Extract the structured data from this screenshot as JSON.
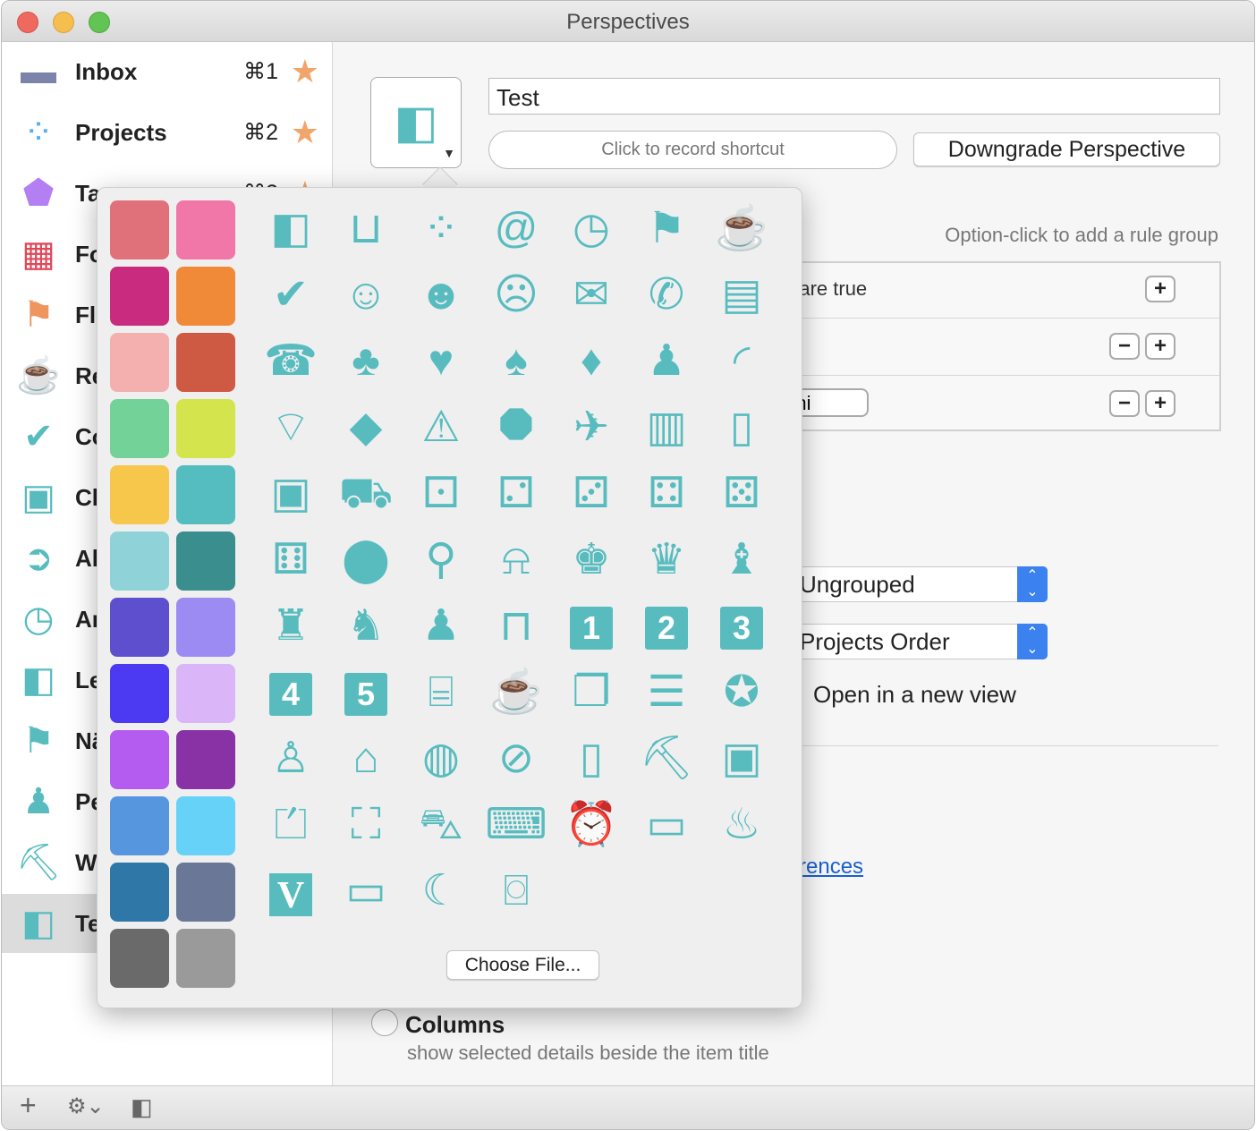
{
  "window": {
    "title": "Perspectives"
  },
  "sidebar": {
    "items": [
      {
        "label": "Inbox",
        "shortcut": "⌘1",
        "icon": "inbox-icon",
        "glyph": "▬",
        "color": "#7c84ac",
        "star": true
      },
      {
        "label": "Projects",
        "shortcut": "⌘2",
        "icon": "projects-icon",
        "glyph": "⁘",
        "color": "#58aef6",
        "star": true
      },
      {
        "label": "Ta",
        "shortcut": "⌘3",
        "icon": "tag-icon",
        "glyph": "⬟",
        "color": "#b37ff2",
        "star": true
      },
      {
        "label": "Fo",
        "icon": "forecast-icon",
        "glyph": "▦",
        "color": "#e0485a"
      },
      {
        "label": "Fl",
        "icon": "flag-icon",
        "glyph": "⚑",
        "color": "#ee9560"
      },
      {
        "label": "Re",
        "icon": "coffee-cup-icon",
        "glyph": "☕",
        "color": "#8e7ee4"
      },
      {
        "label": "Co",
        "icon": "checkmark-icon",
        "glyph": "✔",
        "color": "#58bcbf"
      },
      {
        "label": "Ch",
        "icon": "calendar-icon",
        "glyph": "▣",
        "color": "#58bcbf"
      },
      {
        "label": "Ak",
        "icon": "chevron-circle-icon",
        "glyph": "➲",
        "color": "#58bcbf"
      },
      {
        "label": "Ar",
        "icon": "clock-icon",
        "glyph": "◷",
        "color": "#58bcbf"
      },
      {
        "label": "Le",
        "icon": "perspective-icon",
        "glyph": "◧",
        "color": "#58bcbf"
      },
      {
        "label": "Nä",
        "icon": "flag-icon",
        "glyph": "⚑",
        "color": "#58bcbf"
      },
      {
        "label": "Pe",
        "icon": "person-icon",
        "glyph": "♟",
        "color": "#58bcbf"
      },
      {
        "label": "W",
        "icon": "toolbox-icon",
        "glyph": "⛏",
        "color": "#58bcbf"
      },
      {
        "label": "Te",
        "icon": "perspective-icon",
        "glyph": "◧",
        "color": "#58bcbf",
        "selected": true
      }
    ]
  },
  "bottom_bar": {
    "add": "+",
    "gear": "⚙⌄",
    "sidebar_toggle": "◧"
  },
  "editor": {
    "name_value": "Test",
    "shortcut_placeholder": "Click to record shortcut",
    "downgrade_label": "Downgrade Perspective",
    "rule_hint": "Option-click to add a rule group",
    "rule_text": "g are true",
    "omni_value": "Omni",
    "grouping_value": "Ungrouped",
    "sorting_value": "Projects Order",
    "open_new_view_label": "Open in a new view",
    "link_text": "rences",
    "columns_label": "Columns",
    "columns_desc": "show selected details beside the item title"
  },
  "popover": {
    "choose_file": "Choose File...",
    "accent": "#58bcbf",
    "swatches": [
      "#e0707a",
      "#f077a8",
      "#c92c7f",
      "#f08a38",
      "#f3b0ae",
      "#cf5a43",
      "#72d298",
      "#d3e44c",
      "#f6c74a",
      "#55bcbf",
      "#8fd3d8",
      "#3a8e8d",
      "#5e4fce",
      "#9b8bf3",
      "#4b3af1",
      "#dab5f7",
      "#b45bf0",
      "#8932a5",
      "#5596de",
      "#67d2f8",
      "#2f77a6",
      "#6b7796",
      "#6a6a6a",
      "#9a9a9a"
    ],
    "icons": [
      {
        "name": "perspective-icon",
        "glyph": "◧"
      },
      {
        "name": "inbox-tray-icon",
        "glyph": "⊔"
      },
      {
        "name": "projects-dots-icon",
        "glyph": "⁘"
      },
      {
        "name": "at-sign-icon",
        "glyph": "@"
      },
      {
        "name": "clock-icon",
        "glyph": "◷"
      },
      {
        "name": "flag-icon",
        "glyph": "⚑"
      },
      {
        "name": "cup-icon",
        "glyph": "☕"
      },
      {
        "name": "checkmark-circle-icon",
        "glyph": "✔"
      },
      {
        "name": "smile-icon",
        "glyph": "☺"
      },
      {
        "name": "neutral-face-icon",
        "glyph": "☻"
      },
      {
        "name": "sad-face-icon",
        "glyph": "☹"
      },
      {
        "name": "envelope-icon",
        "glyph": "✉"
      },
      {
        "name": "phone-handset-icon",
        "glyph": "✆"
      },
      {
        "name": "floppy-disk-icon",
        "glyph": "▤"
      },
      {
        "name": "telephone-icon",
        "glyph": "☎"
      },
      {
        "name": "club-icon",
        "glyph": "♣"
      },
      {
        "name": "heart-icon",
        "glyph": "♥"
      },
      {
        "name": "spade-icon",
        "glyph": "♠"
      },
      {
        "name": "diamond-icon",
        "glyph": "♦"
      },
      {
        "name": "person-icon",
        "glyph": "♟"
      },
      {
        "name": "rss-icon",
        "glyph": "◜"
      },
      {
        "name": "wifi-icon",
        "glyph": "⌔"
      },
      {
        "name": "warning-diamond-icon",
        "glyph": "◆"
      },
      {
        "name": "warning-triangle-icon",
        "glyph": "⚠"
      },
      {
        "name": "warning-octagon-icon",
        "glyph": "⯃"
      },
      {
        "name": "airplane-icon",
        "glyph": "✈"
      },
      {
        "name": "bus-icon",
        "glyph": "▥"
      },
      {
        "name": "train-icon",
        "glyph": "▯"
      },
      {
        "name": "bus-front-icon",
        "glyph": "▣"
      },
      {
        "name": "taxi-icon",
        "glyph": "⛟"
      },
      {
        "name": "die-one-icon",
        "glyph": "⚀"
      },
      {
        "name": "die-two-icon",
        "glyph": "⚁"
      },
      {
        "name": "die-three-icon",
        "glyph": "⚂"
      },
      {
        "name": "die-four-icon",
        "glyph": "⚃"
      },
      {
        "name": "die-five-icon",
        "glyph": "⚄"
      },
      {
        "name": "die-six-icon",
        "glyph": "⚅"
      },
      {
        "name": "eight-ball-icon",
        "glyph": "⬤"
      },
      {
        "name": "lightbulb-icon",
        "glyph": "⚲"
      },
      {
        "name": "bell-icon",
        "glyph": "⍾"
      },
      {
        "name": "chess-king-icon",
        "glyph": "♚"
      },
      {
        "name": "crown-icon",
        "glyph": "♛"
      },
      {
        "name": "chess-bishop-icon",
        "glyph": "♝"
      },
      {
        "name": "chess-rook-icon",
        "glyph": "♜"
      },
      {
        "name": "chess-knight-icon",
        "glyph": "♞"
      },
      {
        "name": "chess-pawn-icon",
        "glyph": "♟"
      },
      {
        "name": "lock-icon",
        "glyph": "⊓"
      },
      {
        "name": "number-one-icon",
        "label": "1"
      },
      {
        "name": "number-two-icon",
        "label": "2"
      },
      {
        "name": "number-three-icon",
        "label": "3"
      },
      {
        "name": "number-four-icon",
        "label": "4"
      },
      {
        "name": "number-five-icon",
        "label": "5"
      },
      {
        "name": "blueprint-icon",
        "glyph": "⌸"
      },
      {
        "name": "mug-icon",
        "glyph": "☕"
      },
      {
        "name": "documents-icon",
        "glyph": "❐"
      },
      {
        "name": "archive-tray-icon",
        "glyph": "☰"
      },
      {
        "name": "star-badge-icon",
        "glyph": "✪"
      },
      {
        "name": "doctor-icon",
        "glyph": "♙"
      },
      {
        "name": "house-icon",
        "glyph": "⌂"
      },
      {
        "name": "tennis-ball-icon",
        "glyph": "◍"
      },
      {
        "name": "safe-icon",
        "glyph": "⊘"
      },
      {
        "name": "smartphone-icon",
        "glyph": "▯"
      },
      {
        "name": "toolbox-icon",
        "glyph": "⛏"
      },
      {
        "name": "calendar-icon",
        "glyph": "▣"
      },
      {
        "name": "scanner-icon",
        "glyph": "⏍"
      },
      {
        "name": "gamepad-icon",
        "glyph": "⛶"
      },
      {
        "name": "car-icon",
        "glyph": "⛍"
      },
      {
        "name": "laptop-icon",
        "glyph": "⌨"
      },
      {
        "name": "alarm-clock-icon",
        "glyph": "⏰"
      },
      {
        "name": "monitor-icon",
        "glyph": "▭"
      },
      {
        "name": "fire-icon",
        "glyph": "♨"
      },
      {
        "name": "letter-v-icon",
        "label": "V"
      },
      {
        "name": "tablet-icon",
        "glyph": "▭"
      },
      {
        "name": "moon-icon",
        "glyph": "☾"
      },
      {
        "name": "camera-icon",
        "glyph": "⌼"
      }
    ]
  }
}
